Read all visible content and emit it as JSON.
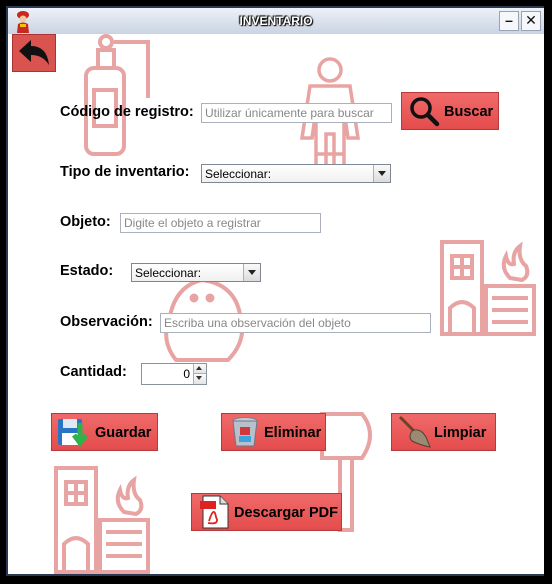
{
  "window": {
    "title": "INVENTARIO",
    "minimize_label": "–",
    "close_label": "✕"
  },
  "form": {
    "codigo": {
      "label": "Código de registro:",
      "placeholder": "Utilizar únicamente para buscar"
    },
    "buscar_label": "Buscar",
    "tipo": {
      "label": "Tipo de inventario:",
      "selected": "Seleccionar:"
    },
    "objeto": {
      "label": "Objeto:",
      "placeholder": "Digite el objeto a registrar"
    },
    "estado": {
      "label": "Estado:",
      "selected": "Seleccionar:"
    },
    "observacion": {
      "label": "Observación:",
      "placeholder": "Escriba una observación del objeto"
    },
    "cantidad": {
      "label": "Cantidad:",
      "value": "0"
    }
  },
  "actions": {
    "guardar": "Guardar",
    "eliminar": "Eliminar",
    "limpiar": "Limpiar",
    "descargar_pdf": "Descargar PDF"
  },
  "icons": {
    "app": "firefighter-icon",
    "back": "back-arrow-icon",
    "search": "magnifier-icon",
    "save": "floppy-save-icon",
    "delete": "recycle-bin-icon",
    "clear": "broom-icon",
    "pdf": "pdf-file-icon"
  },
  "colors": {
    "button_red": "#e44c4c",
    "decor_red": "#e8a3a3",
    "title_gradient_top": "#eef2f8"
  }
}
